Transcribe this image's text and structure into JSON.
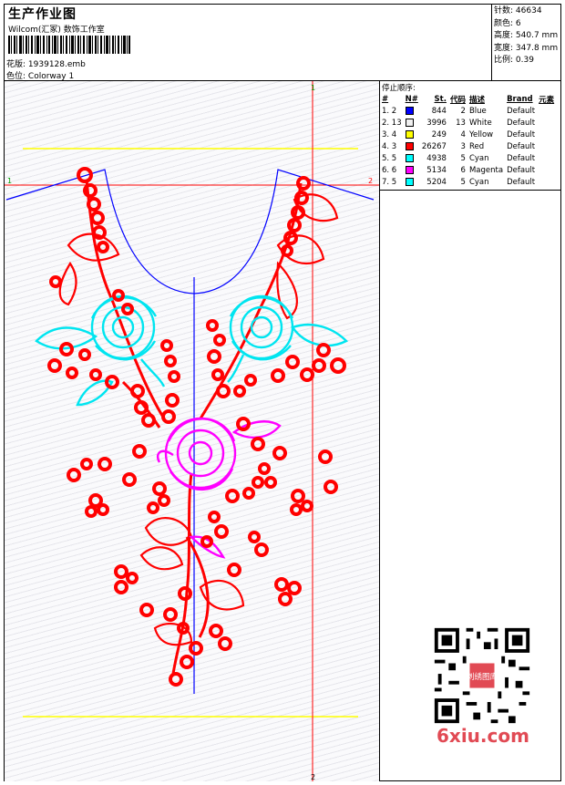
{
  "header": {
    "title": "生产作业图",
    "subtitle": "Wilcom(汇冢) 数饰工作室",
    "design_label": "花版:",
    "design_file": "1939128.emb",
    "colorway_label": "色位:",
    "colorway": "Colorway 1"
  },
  "stats": {
    "stitches_label": "针数:",
    "stitches": "46634",
    "colors_label": "颜色:",
    "colors": "6",
    "height_label": "高度:",
    "height": "540.7 mm",
    "width_label": "宽度:",
    "width": "347.8 mm",
    "scale_label": "比例:",
    "scale": "0.39"
  },
  "stop_sequence": {
    "title": "停止顺序:",
    "columns": [
      "#",
      "N#",
      "St.",
      "代码",
      "描述",
      "Brand",
      "元素"
    ],
    "rows": [
      {
        "num": "1. 2",
        "color": "#0000ff",
        "st": "844",
        "code": "2",
        "desc": "Blue",
        "brand": "Default"
      },
      {
        "num": "2. 13",
        "color": "#f0f0f0",
        "st": "3996",
        "code": "13",
        "desc": "White",
        "brand": "Default"
      },
      {
        "num": "3. 4",
        "color": "#ffff00",
        "st": "249",
        "code": "4",
        "desc": "Yellow",
        "brand": "Default"
      },
      {
        "num": "4. 3",
        "color": "#ff0000",
        "st": "26267",
        "code": "3",
        "desc": "Red",
        "brand": "Default"
      },
      {
        "num": "5. 5",
        "color": "#00ffff",
        "st": "4938",
        "code": "5",
        "desc": "Cyan",
        "brand": "Default"
      },
      {
        "num": "6. 6",
        "color": "#ff00ff",
        "st": "5134",
        "code": "6",
        "desc": "Magenta",
        "brand": "Default"
      },
      {
        "num": "7. 5",
        "color": "#00ffff",
        "st": "5204",
        "code": "5",
        "desc": "Cyan",
        "brand": "Default"
      }
    ]
  },
  "guides": {
    "v_top": "1",
    "v_bottom": "2",
    "h_left": "1",
    "h_right": "2"
  },
  "watermark": {
    "site": "6xiu.com",
    "badge": "刺绣图库"
  },
  "palette": {
    "red": "#ff0000",
    "cyan": "#00e5f0",
    "magenta": "#ff00ff",
    "blue": "#0000ff",
    "yellow": "#ffff00"
  }
}
